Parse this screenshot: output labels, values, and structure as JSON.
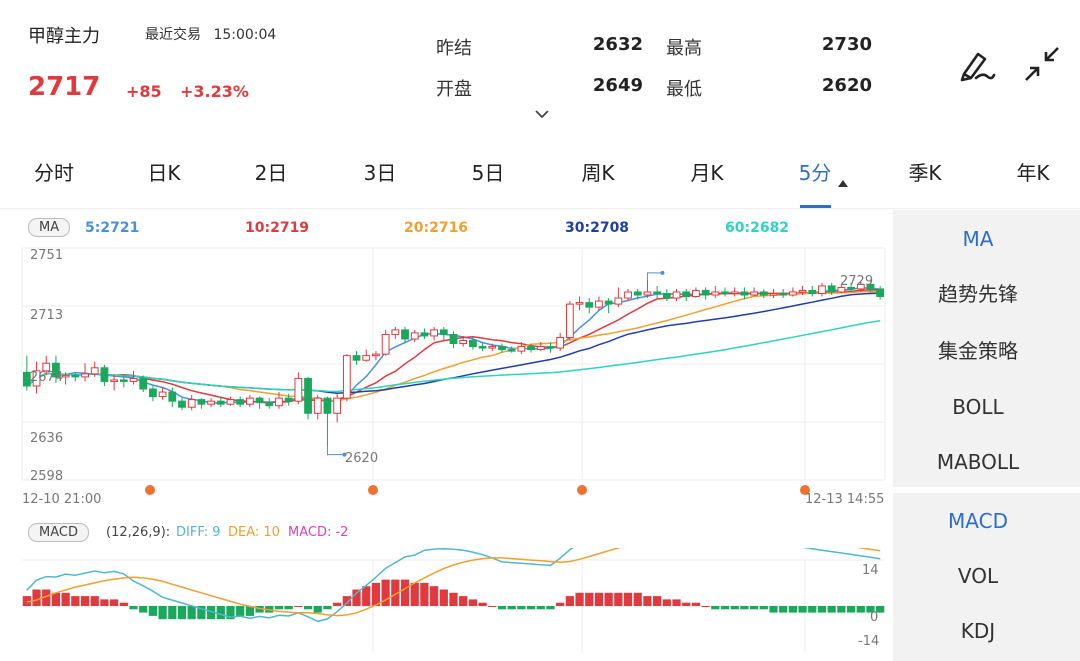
{
  "header": {
    "name": "甲醇主力",
    "trade_label": "最近交易",
    "trade_time": "15:00:04",
    "price": "2717",
    "change": "+85",
    "change_pct": "+3.23%",
    "prev_settle_label": "昨结",
    "prev_settle": "2632",
    "open_label": "开盘",
    "open": "2649",
    "high_label": "最高",
    "high": "2730",
    "low_label": "最低",
    "low": "2620"
  },
  "tabs": [
    "分时",
    "日K",
    "2日",
    "3日",
    "5日",
    "周K",
    "月K",
    "5分",
    "季K",
    "年K"
  ],
  "active_tab": "5分",
  "ma_legend": {
    "badge": "MA",
    "ma5": "5:2721",
    "ma10": "10:2719",
    "ma20": "20:2716",
    "ma30": "30:2708",
    "ma60": "60:2682"
  },
  "colors": {
    "up": "#e0393e",
    "down": "#1aa85c",
    "ma5": "#4a90e2",
    "ma10": "#e0393e",
    "ma20": "#f0a030",
    "ma30": "#1f3ea8",
    "ma60": "#2dd4bf",
    "dif": "#4fb8d0",
    "dea": "#f0a030",
    "macd": "#e040c0",
    "accent": "#2f6dcc"
  },
  "price_axis": [
    "2751",
    "2713",
    "2674",
    "2636",
    "2598"
  ],
  "time_axis": {
    "start": "12-10 21:00",
    "end": "12-13 14:55"
  },
  "markers": {
    "low_label": "2620",
    "high_label": "2729"
  },
  "macd_legend": {
    "badge": "MACD",
    "params": "(12,26,9):",
    "dif": "DIFF: 9",
    "dea": "DEA: 10",
    "macd": "MACD: -2"
  },
  "macd_axis": [
    "14",
    "0",
    "-14"
  ],
  "right_panel": {
    "main_indicators": [
      "MA",
      "趋势先锋",
      "集金策略",
      "BOLL",
      "MABOLL"
    ],
    "sub_indicators": [
      "MACD",
      "VOL",
      "KDJ"
    ],
    "active_main": "MA",
    "active_sub": "MACD"
  },
  "chart_data": {
    "type": "candlestick",
    "y_range": [
      2598,
      2751
    ],
    "candles": [
      [
        2669,
        2660,
        2680,
        2657
      ],
      [
        2660,
        2670,
        2676,
        2655
      ],
      [
        2670,
        2675,
        2680,
        2667
      ],
      [
        2675,
        2666,
        2680,
        2662
      ],
      [
        2666,
        2667,
        2669,
        2661
      ],
      [
        2667,
        2666,
        2669,
        2663
      ],
      [
        2666,
        2668,
        2675,
        2663
      ],
      [
        2668,
        2672,
        2676,
        2666
      ],
      [
        2672,
        2663,
        2674,
        2660
      ],
      [
        2663,
        2664,
        2668,
        2657
      ],
      [
        2664,
        2663,
        2667,
        2659
      ],
      [
        2663,
        2665,
        2670,
        2661
      ],
      [
        2665,
        2658,
        2667,
        2656
      ],
      [
        2658,
        2653,
        2660,
        2650
      ],
      [
        2653,
        2656,
        2659,
        2651
      ],
      [
        2656,
        2650,
        2659,
        2646
      ],
      [
        2650,
        2646,
        2652,
        2644
      ],
      [
        2646,
        2651,
        2654,
        2644
      ],
      [
        2651,
        2648,
        2652,
        2645
      ],
      [
        2648,
        2650,
        2652,
        2646
      ],
      [
        2650,
        2648,
        2653,
        2646
      ],
      [
        2648,
        2651,
        2653,
        2647
      ],
      [
        2651,
        2648,
        2653,
        2646
      ],
      [
        2648,
        2652,
        2654,
        2646
      ],
      [
        2652,
        2649,
        2653,
        2645
      ],
      [
        2649,
        2647,
        2652,
        2645
      ],
      [
        2647,
        2652,
        2656,
        2645
      ],
      [
        2652,
        2650,
        2655,
        2647
      ],
      [
        2650,
        2665,
        2669,
        2648
      ],
      [
        2665,
        2642,
        2666,
        2638
      ],
      [
        2642,
        2652,
        2654,
        2638
      ],
      [
        2652,
        2642,
        2653,
        2620
      ],
      [
        2642,
        2652,
        2655,
        2636
      ],
      [
        2652,
        2680,
        2681,
        2650
      ],
      [
        2680,
        2677,
        2683,
        2674
      ],
      [
        2677,
        2680,
        2684,
        2676
      ],
      [
        2680,
        2681,
        2683,
        2677
      ],
      [
        2681,
        2694,
        2697,
        2680
      ],
      [
        2694,
        2697,
        2699,
        2691
      ],
      [
        2697,
        2691,
        2699,
        2688
      ],
      [
        2691,
        2695,
        2697,
        2689
      ],
      [
        2695,
        2693,
        2698,
        2691
      ],
      [
        2693,
        2697,
        2699,
        2690
      ],
      [
        2697,
        2694,
        2699,
        2690
      ],
      [
        2694,
        2688,
        2696,
        2685
      ],
      [
        2688,
        2690,
        2693,
        2686
      ],
      [
        2690,
        2686,
        2692,
        2684
      ],
      [
        2686,
        2685,
        2689,
        2683
      ],
      [
        2685,
        2686,
        2688,
        2683
      ],
      [
        2686,
        2684,
        2688,
        2682
      ],
      [
        2684,
        2683,
        2686,
        2682
      ],
      [
        2683,
        2686,
        2689,
        2681
      ],
      [
        2686,
        2684,
        2688,
        2682
      ],
      [
        2684,
        2686,
        2689,
        2683
      ],
      [
        2686,
        2685,
        2689,
        2682
      ],
      [
        2685,
        2692,
        2695,
        2683
      ],
      [
        2692,
        2714,
        2716,
        2690
      ],
      [
        2714,
        2715,
        2719,
        2710
      ],
      [
        2715,
        2712,
        2718,
        2708
      ],
      [
        2712,
        2716,
        2719,
        2710
      ],
      [
        2716,
        2714,
        2718,
        2708
      ],
      [
        2714,
        2718,
        2725,
        2712
      ],
      [
        2718,
        2722,
        2724,
        2716
      ],
      [
        2722,
        2720,
        2724,
        2717
      ],
      [
        2720,
        2722,
        2730,
        2718
      ],
      [
        2722,
        2721,
        2726,
        2718
      ],
      [
        2721,
        2718,
        2724,
        2716
      ],
      [
        2718,
        2722,
        2724,
        2716
      ],
      [
        2722,
        2719,
        2724,
        2716
      ],
      [
        2719,
        2723,
        2725,
        2718
      ],
      [
        2723,
        2720,
        2725,
        2717
      ],
      [
        2720,
        2722,
        2726,
        2718
      ],
      [
        2722,
        2721,
        2725,
        2719
      ],
      [
        2721,
        2722,
        2725,
        2719
      ],
      [
        2722,
        2720,
        2725,
        2717
      ],
      [
        2720,
        2722,
        2725,
        2719
      ],
      [
        2722,
        2720,
        2724,
        2718
      ],
      [
        2720,
        2721,
        2724,
        2718
      ],
      [
        2721,
        2720,
        2724,
        2718
      ],
      [
        2720,
        2722,
        2725,
        2719
      ],
      [
        2722,
        2723,
        2726,
        2720
      ],
      [
        2723,
        2721,
        2726,
        2719
      ],
      [
        2721,
        2726,
        2728,
        2719
      ],
      [
        2726,
        2722,
        2728,
        2720
      ],
      [
        2722,
        2725,
        2727,
        2721
      ],
      [
        2725,
        2724,
        2728,
        2722
      ],
      [
        2724,
        2727,
        2729,
        2722
      ],
      [
        2727,
        2724,
        2729,
        2722
      ],
      [
        2724,
        2719,
        2726,
        2717
      ]
    ],
    "macd_histogram": [
      3,
      5,
      5,
      4,
      4,
      3,
      3,
      3,
      2,
      2,
      1,
      -1,
      -2,
      -3,
      -4,
      -4,
      -4,
      -4,
      -4,
      -4,
      -4,
      -4,
      -3,
      -3,
      -2,
      -2,
      -1,
      -1,
      0,
      -1,
      -2,
      -1,
      1,
      3,
      5,
      6,
      7,
      8,
      8,
      8,
      7,
      7,
      6,
      5,
      4,
      3,
      2,
      1,
      0,
      -1,
      -1,
      -1,
      -1,
      -1,
      -1,
      1,
      3,
      4,
      4,
      4,
      4,
      4,
      4,
      4,
      3,
      3,
      2,
      2,
      1,
      1,
      0,
      -1,
      -1,
      -1,
      -1,
      -1,
      -1,
      -2,
      -2,
      -2,
      -2,
      -2,
      -2,
      -2,
      -2,
      -2,
      -2,
      -2,
      -2
    ]
  }
}
